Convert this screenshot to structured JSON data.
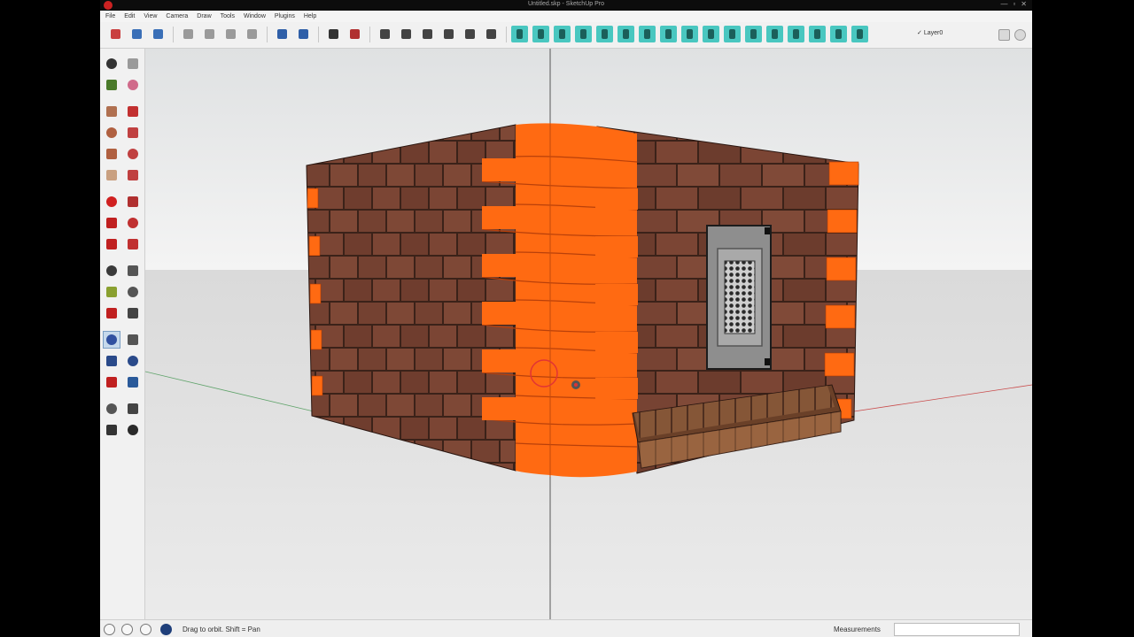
{
  "window": {
    "title": "Untitled.skp - SketchUp Pro",
    "controls": [
      "—",
      "▫",
      "✕"
    ]
  },
  "menu": [
    "File",
    "Edit",
    "View",
    "Camera",
    "Draw",
    "Tools",
    "Window",
    "Plugins",
    "Help"
  ],
  "layer": {
    "check": "✓",
    "name": "Layer0"
  },
  "colors": {
    "accent": "#49c7c0",
    "brick": "#7a4532",
    "orange": "#ff6a12",
    "background_sky": "#e6e7e7",
    "ground": "#d6d6d6"
  },
  "toolbar_icons": [
    "new-icon",
    "open-icon",
    "save-icon",
    "cut-icon",
    "copy-icon",
    "paste-icon",
    "erase-icon",
    "undo-icon",
    "redo-icon",
    "print-icon",
    "model-info-icon",
    "iso-view-icon",
    "top-view-icon",
    "front-view-icon",
    "right-view-icon",
    "back-view-icon",
    "left-view-icon",
    "sandbox-1-icon",
    "sandbox-2-icon",
    "sandbox-3-icon",
    "sandbox-4-icon",
    "sandbox-5-icon",
    "sandbox-6-icon",
    "sandbox-7-icon",
    "sandbox-8-icon",
    "sandbox-9-icon",
    "sandbox-10-icon",
    "sandbox-11-icon",
    "sandbox-12-icon",
    "sandbox-13-icon",
    "sandbox-14-icon",
    "sandbox-15-icon",
    "sandbox-16-icon",
    "sandbox-17-icon"
  ],
  "left_tools": [
    "select-icon",
    "component-icon",
    "paint-bucket-icon",
    "eraser-icon",
    "rectangle-icon",
    "line-icon",
    "circle-icon",
    "freehand-icon",
    "polygon-icon",
    "arc-icon",
    "pie-icon",
    "two-point-arc-icon",
    "move-icon",
    "push-pull-icon",
    "rotate-icon",
    "follow-me-icon",
    "scale-icon",
    "offset-icon",
    "tape-measure-icon",
    "dimension-icon",
    "protractor-icon",
    "text-icon",
    "axes-icon",
    "3d-text-icon",
    "orbit-icon",
    "pan-icon",
    "zoom-icon",
    "zoom-window-icon",
    "zoom-extents-icon",
    "previous-view-icon",
    "position-camera-icon",
    "look-around-icon",
    "walk-icon",
    "section-plane-icon"
  ],
  "status": {
    "hint": "Drag to orbit.  Shift = Pan",
    "measurements_label": "Measurements",
    "measurements_value": ""
  }
}
